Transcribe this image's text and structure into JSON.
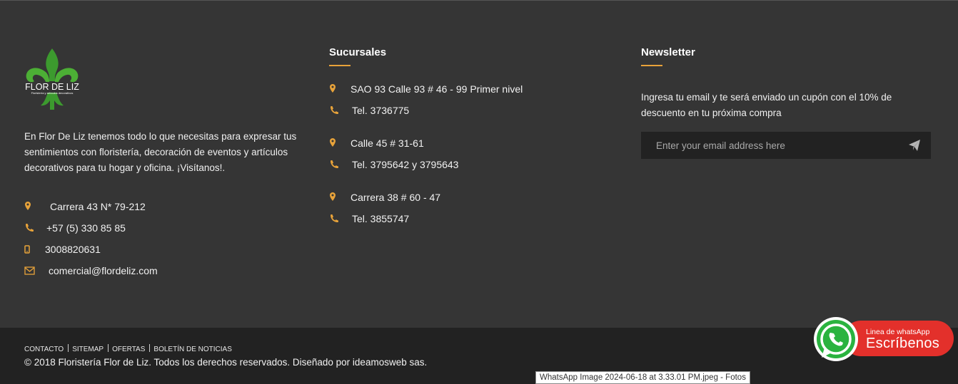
{
  "about": {
    "logo_text": "FLOR DE LIZ",
    "logo_subtext": "Floristería y artículos decorativos",
    "description": "En Flor De Liz tenemos todo lo que necesitas para expresar tus sentimientos con floristería, decoración de eventos y artículos decorativos para tu hogar y oficina. ¡Visítanos!.",
    "contacts": [
      {
        "icon": "map-marker-icon",
        "text": "Carrera 43 N* 79-212"
      },
      {
        "icon": "phone-icon",
        "text": "+57 (5) 330 85 85"
      },
      {
        "icon": "mobile-icon",
        "text": "3008820631"
      },
      {
        "icon": "envelope-icon",
        "text": "comercial@flordeliz.com"
      }
    ]
  },
  "branches": {
    "heading": "Sucursales",
    "items": [
      {
        "address": "SAO 93 Calle 93 # 46 - 99 Primer nivel",
        "phone": "Tel. 3736775"
      },
      {
        "address": "Calle 45 # 31-61",
        "phone": "Tel. 3795642 y 3795643"
      },
      {
        "address": "Carrera 38 # 60 - 47",
        "phone": "Tel. 3855747"
      }
    ]
  },
  "newsletter": {
    "heading": "Newsletter",
    "text": "Ingresa tu email y te será enviado un cupón con el 10% de descuento en tu próxima compra",
    "placeholder": "Enter your email address here",
    "send_icon": "paper-plane-icon"
  },
  "footer": {
    "links": [
      "CONTACTO",
      "SITEMAP",
      "OFERTAS",
      "BOLETÍN DE NOTICIAS"
    ],
    "copyright": "© 2018 Floristería Flor de Liz. Todos los derechos reservados. Diseñado por ideamosweb sas."
  },
  "whatsapp": {
    "line1": "Linea de whatsApp",
    "line2": "Escríbenos"
  },
  "tooltip": "WhatsApp Image 2024-06-18 at 3.33.01 PM.jpeg - Fotos",
  "colors": {
    "background": "#353535",
    "bottom_bar": "#222222",
    "accent": "#e8a33a",
    "whatsapp_red": "#e3302b",
    "whatsapp_green": "#2ab33f"
  }
}
